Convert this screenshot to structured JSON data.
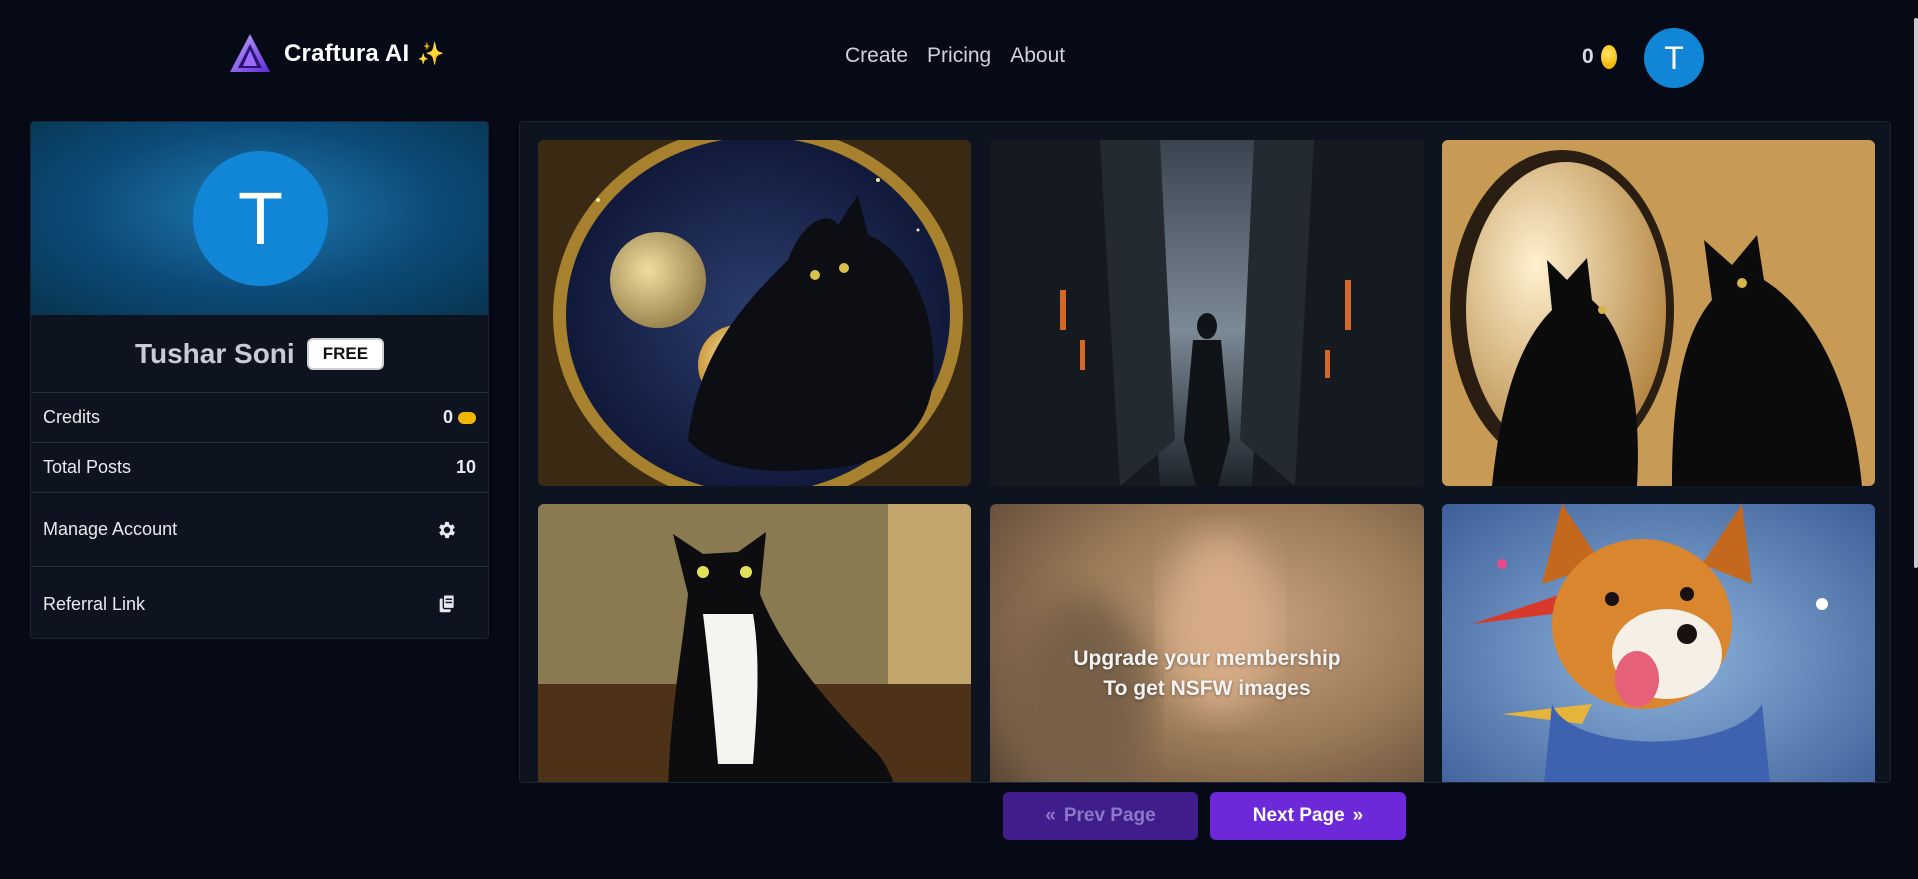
{
  "header": {
    "brand_name": "Craftura AI",
    "brand_sparkle": "✨",
    "nav": [
      "Create",
      "Pricing",
      "About"
    ],
    "credits": "0",
    "avatar_initial": "T"
  },
  "profile": {
    "avatar_initial": "T",
    "name": "Tushar Soni",
    "plan": "FREE",
    "stats": [
      {
        "label": "Credits",
        "value": "0"
      },
      {
        "label": "Total Posts",
        "value": "10"
      }
    ],
    "actions": [
      {
        "label": "Manage Account",
        "icon": "gear-icon"
      },
      {
        "label": "Referral Link",
        "icon": "copy-icon"
      }
    ]
  },
  "gallery": {
    "images": [
      {
        "subject": "black-cat-moon-art"
      },
      {
        "subject": "cyberpunk-alley-figure"
      },
      {
        "subject": "black-cat-mirror-reflection"
      },
      {
        "subject": "tuxedo-cat-painting"
      },
      {
        "subject": "nsfw-blurred",
        "overlay_line1": "Upgrade your membership",
        "overlay_line2": "To get NSFW images"
      },
      {
        "subject": "colorful-dog-painting"
      }
    ]
  },
  "pagination": {
    "prev_label": "Prev Page",
    "next_label": "Next Page",
    "prev_icon": "chevrons-left-icon",
    "next_icon": "chevrons-right-icon"
  },
  "colors": {
    "background": "#050a16",
    "panel": "#0e1320",
    "avatar": "#1186d6",
    "accent": "#6d28d9",
    "accent_muted": "#3f1d8a"
  }
}
